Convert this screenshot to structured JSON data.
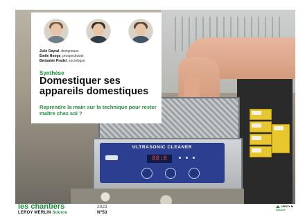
{
  "panel_brand": "ULTRASONIC CLEANER",
  "panel_display": "88:8",
  "authors": [
    {
      "name": "Julie Gayral",
      "role": "designeuse"
    },
    {
      "name": "Émile Hooge",
      "role": "prospectiviste"
    },
    {
      "name": "Benjamin Pradel",
      "role": "sociologue"
    }
  ],
  "kicker": "Synthèse",
  "title": "Domestiquer ses appareils domestiques",
  "subtitle": "Reprendre la main sur la technique pour rester maître chez soi ?",
  "footer": {
    "logo_main": "les chantiers",
    "logo_sub_a": "LEROY MERLIN",
    "logo_sub_b": "Source",
    "year": "2023",
    "issue": "N°53",
    "brand_right_a": "LEROY M",
    "brand_right_b": "Source"
  },
  "colors": {
    "accent_green": "#1a8f3a",
    "panel_blue": "#2b3e8f"
  }
}
